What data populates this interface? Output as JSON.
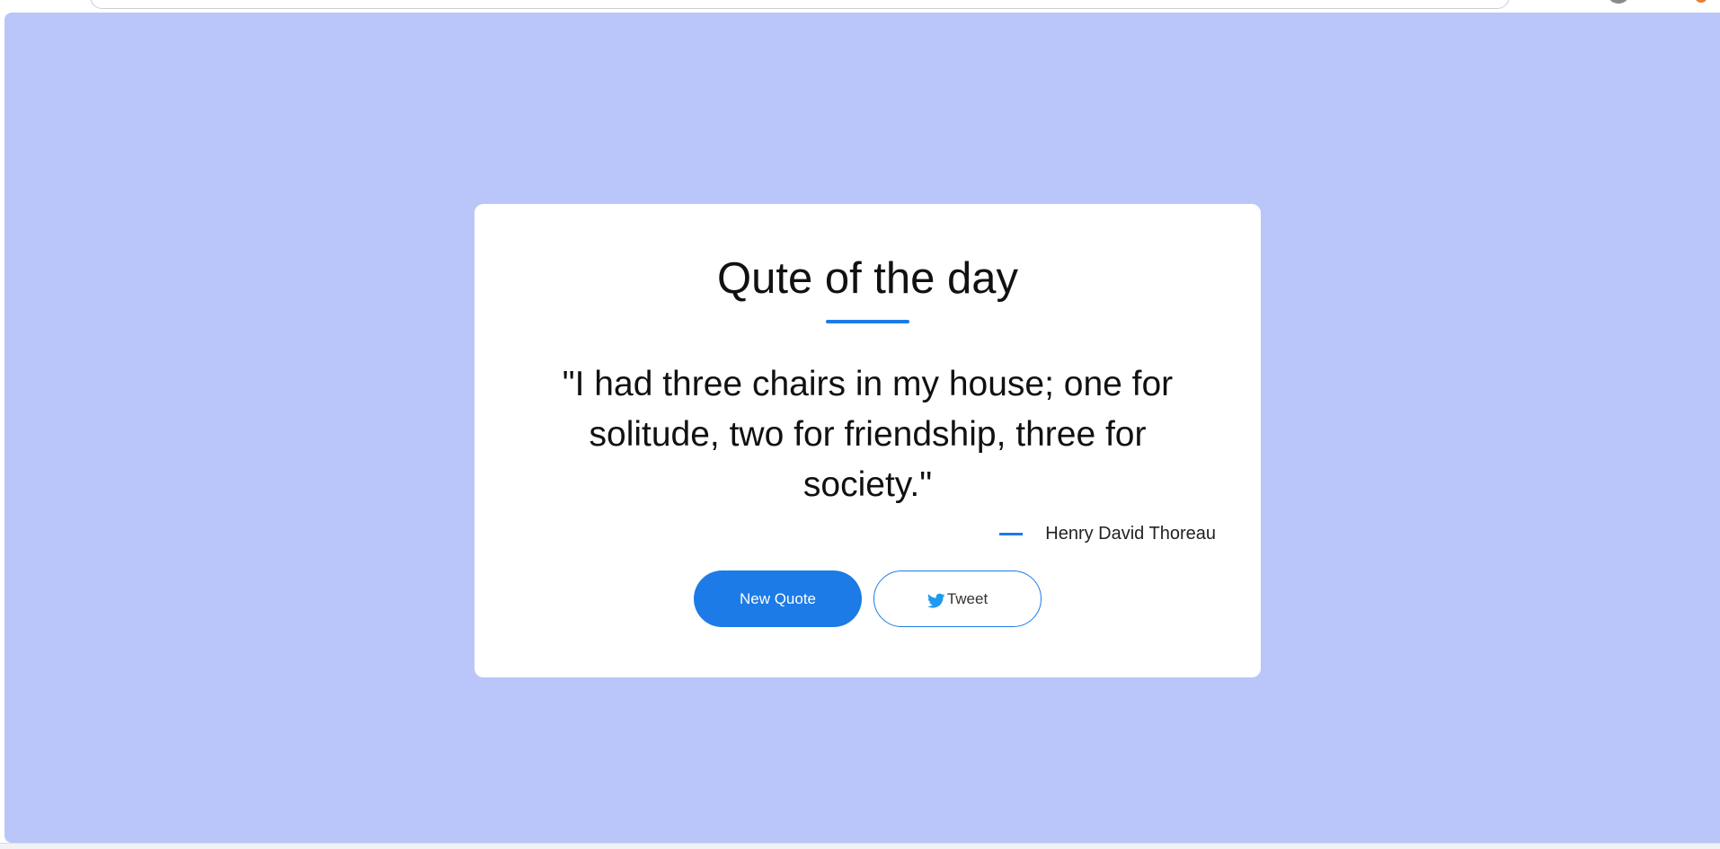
{
  "page": {
    "background_color": "#bac5f9",
    "accent_color": "#1c7be6"
  },
  "card": {
    "title": "Qute of the day",
    "quote": "\"I had three chairs in my house; one for solitude, two for friendship, three for society.\"",
    "author": "Henry David Thoreau"
  },
  "buttons": {
    "new_quote_label": "New Quote",
    "tweet_label": "Tweet",
    "tweet_icon": "twitter-bird-icon"
  }
}
